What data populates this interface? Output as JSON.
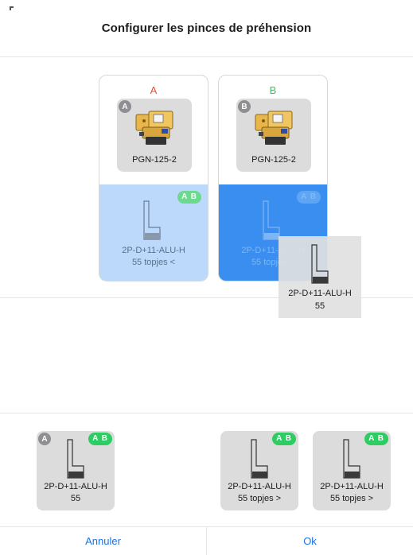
{
  "header": {
    "title": "Configurer les pinces de préhension"
  },
  "grippers": [
    {
      "letter": "A",
      "letter_color": "#e74c3c",
      "badge": "A",
      "name": "PGN-125-2",
      "slot": {
        "badge": "A B",
        "line1": "2P-D+11-ALU-H",
        "line2": "55 topjes <",
        "state": "assigned"
      }
    },
    {
      "letter": "B",
      "letter_color": "#34c759",
      "badge": "B",
      "name": "PGN-125-2",
      "slot": {
        "badge": "A B",
        "line1": "2P-D+11-ALU-H",
        "line2": "55 topjes >",
        "state": "drop-target-highlighted"
      }
    }
  ],
  "drag_ghost": {
    "line1": "2P-D+11-ALU-H",
    "line2": "55"
  },
  "finger_pool": [
    {
      "letter_badge": "A",
      "ab_badge": "A B",
      "line1": "2P-D+11-ALU-H",
      "line2": "55"
    },
    {
      "letter_badge": "",
      "ab_badge": "A B",
      "line1": "2P-D+11-ALU-H",
      "line2": "55 topjes >"
    },
    {
      "letter_badge": "",
      "ab_badge": "A B",
      "line1": "2P-D+11-ALU-H",
      "line2": "55 topjes >"
    }
  ],
  "footer": {
    "cancel_label": "Annuler",
    "ok_label": "Ok"
  },
  "icons": {
    "gripper": "gripper-module-icon",
    "finger": "finger-jaw-icon"
  },
  "colors": {
    "accent": "#1a73e8",
    "badge_green": "#2ecc62",
    "slot_light": "#bcd9fb",
    "slot_active": "#3a8ef0"
  }
}
